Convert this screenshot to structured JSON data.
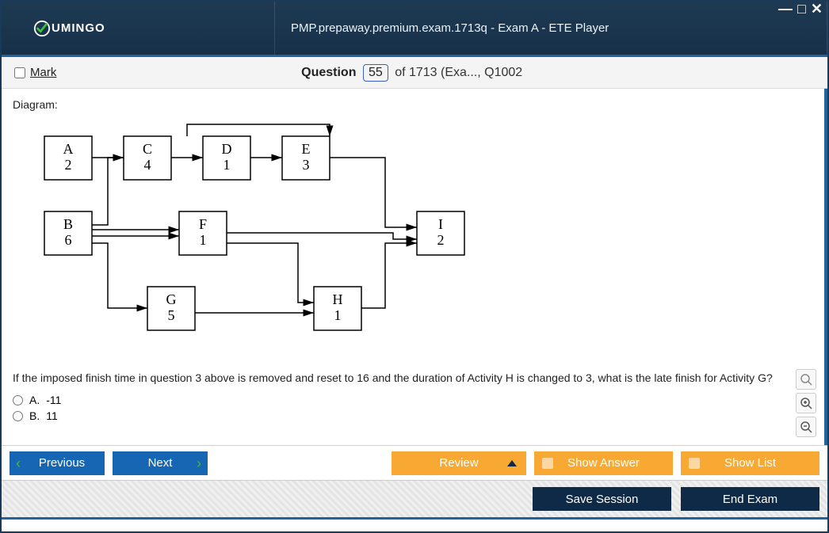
{
  "titlebar": {
    "brand": "UMINGO",
    "title": "PMP.prepaway.premium.exam.1713q - Exam A - ETE Player"
  },
  "header": {
    "mark_label": "Mark",
    "question_word": "Question",
    "question_number": "55",
    "of_text": "of 1713 (Exa..., Q1002"
  },
  "content": {
    "diagram_label": "Diagram:",
    "question_text": "If the imposed finish time in question 3 above is removed and reset to 16 and the duration of Activity H is changed to 3, what is the late finish for Activity G?",
    "answers": [
      {
        "letter": "A.",
        "text": "-11"
      },
      {
        "letter": "B.",
        "text": "11"
      }
    ]
  },
  "toolbar": {
    "previous": "Previous",
    "next": "Next",
    "review": "Review",
    "show_answer": "Show Answer",
    "show_list": "Show List",
    "save_session": "Save Session",
    "end_exam": "End Exam"
  },
  "chart_data": {
    "type": "network-diagram",
    "nodes": [
      {
        "id": "A",
        "duration": 2
      },
      {
        "id": "B",
        "duration": 6
      },
      {
        "id": "C",
        "duration": 4
      },
      {
        "id": "D",
        "duration": 1
      },
      {
        "id": "E",
        "duration": 3
      },
      {
        "id": "F",
        "duration": 1
      },
      {
        "id": "G",
        "duration": 5
      },
      {
        "id": "H",
        "duration": 1
      },
      {
        "id": "I",
        "duration": 2
      }
    ],
    "edges": [
      [
        "A",
        "C"
      ],
      [
        "B",
        "C"
      ],
      [
        "C",
        "D"
      ],
      [
        "D",
        "E"
      ],
      [
        "B",
        "F"
      ],
      [
        "B",
        "G"
      ],
      [
        "E",
        "I"
      ],
      [
        "F",
        "I"
      ],
      [
        "G",
        "H"
      ],
      [
        "F",
        "H"
      ],
      [
        "H",
        "I"
      ]
    ]
  }
}
